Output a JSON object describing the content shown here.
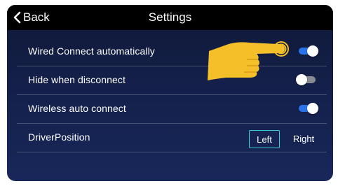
{
  "header": {
    "back_label": "Back",
    "title": "Settings"
  },
  "settings": [
    {
      "label": "Wired Connect automatically",
      "state": "on"
    },
    {
      "label": "Hide when disconnect",
      "state": "off"
    },
    {
      "label": "Wireless auto connect",
      "state": "on"
    }
  ],
  "driver_position": {
    "label": "DriverPosition",
    "options": [
      "Left",
      "Right"
    ],
    "selected": "Left"
  },
  "colors": {
    "toggle_on": "#2b73e8",
    "toggle_off": "#8a8c95",
    "selected_border": "#3ad0d6",
    "pointer": "#f5bf2a"
  }
}
